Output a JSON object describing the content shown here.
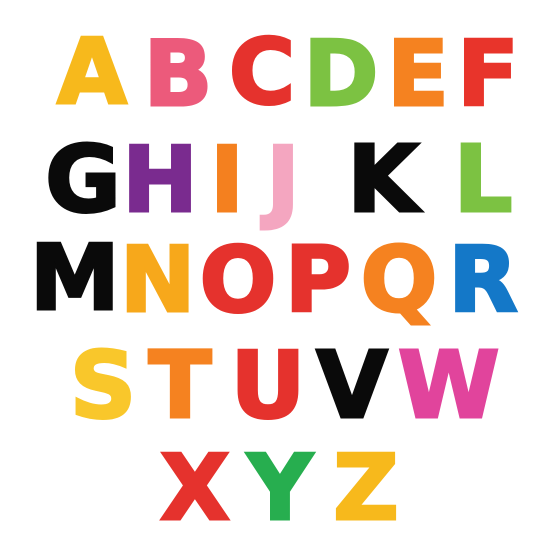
{
  "letters": {
    "a": {
      "char": "A",
      "color": "#F7B91C"
    },
    "b": {
      "char": "B",
      "color": "#EC5A7B"
    },
    "c": {
      "char": "C",
      "color": "#E5322D"
    },
    "d": {
      "char": "D",
      "color": "#7CC242"
    },
    "e": {
      "char": "E",
      "color": "#F58220"
    },
    "f": {
      "char": "F",
      "color": "#E8342B"
    },
    "g": {
      "char": "G",
      "color": "#0A0A0A"
    },
    "h": {
      "char": "H",
      "color": "#7A2B8F"
    },
    "i": {
      "char": "I",
      "color": "#F4801F"
    },
    "j": {
      "char": "J",
      "color": "#F4A6C0"
    },
    "k": {
      "char": "K",
      "color": "#0A0A0A"
    },
    "l": {
      "char": "L",
      "color": "#7CC242"
    },
    "m": {
      "char": "M",
      "color": "#0A0A0A"
    },
    "n": {
      "char": "N",
      "color": "#F7A81B"
    },
    "o": {
      "char": "O",
      "color": "#E5322D"
    },
    "p": {
      "char": "P",
      "color": "#E5322D"
    },
    "q": {
      "char": "Q",
      "color": "#F58220"
    },
    "r": {
      "char": "R",
      "color": "#1478C8"
    },
    "s": {
      "char": "S",
      "color": "#F9C72B"
    },
    "t": {
      "char": "T",
      "color": "#F58220"
    },
    "u": {
      "char": "U",
      "color": "#E5322D"
    },
    "v": {
      "char": "V",
      "color": "#0A0A0A"
    },
    "w": {
      "char": "W",
      "color": "#E1449C"
    },
    "x": {
      "char": "X",
      "color": "#E5322D"
    },
    "y": {
      "char": "Y",
      "color": "#27AE4F"
    },
    "z": {
      "char": "Z",
      "color": "#F7B91C"
    }
  }
}
